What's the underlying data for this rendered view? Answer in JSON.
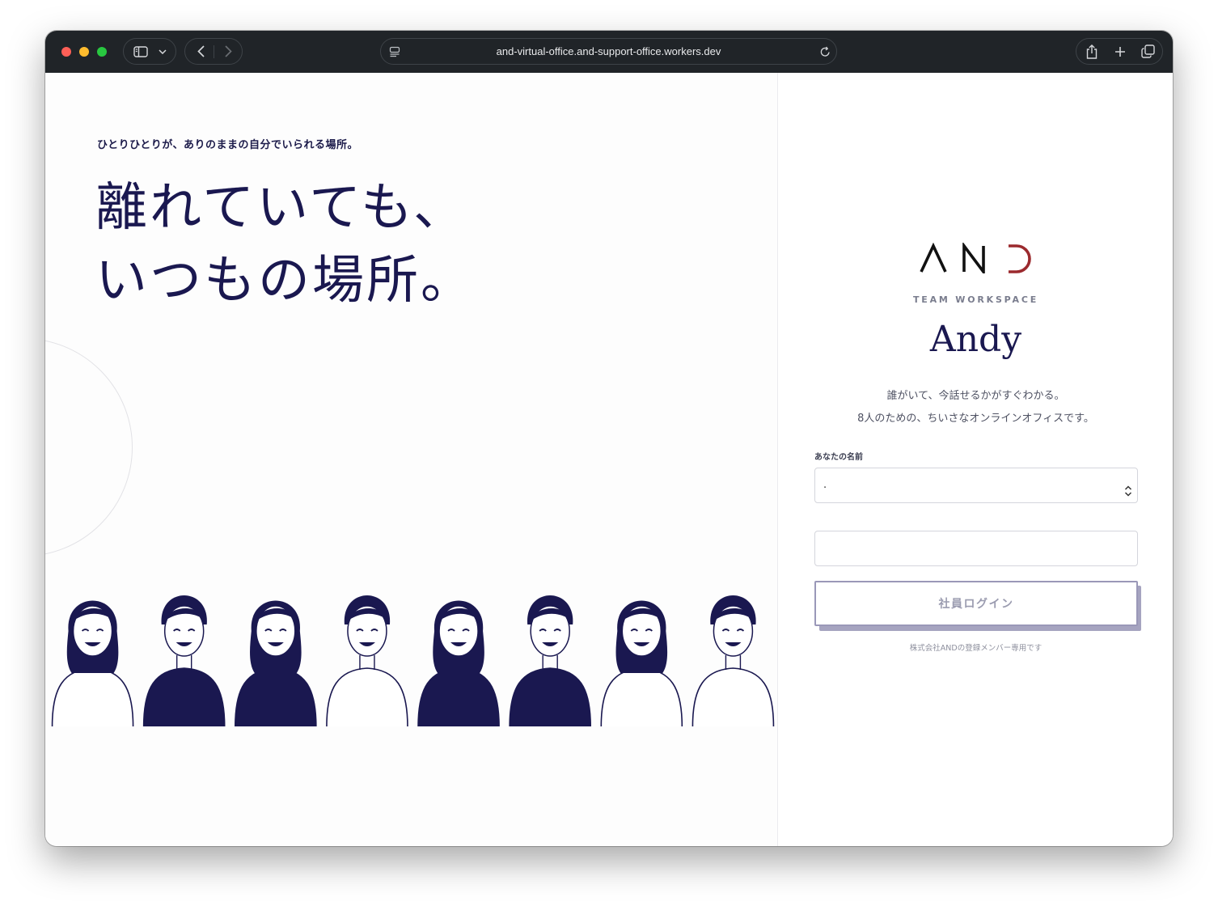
{
  "browser": {
    "url": "and-virtual-office.and-support-office.workers.dev"
  },
  "hero": {
    "tagline": "ひとりひとりが、ありのままの自分でいられる場所。",
    "headline_line1": "離れていても、",
    "headline_line2": "いつもの場所。",
    "illustration": "team-members-illustration",
    "member_count": 8
  },
  "login": {
    "logo_text": "AND",
    "workspace_label": "TEAM WORKSPACE",
    "app_name": "Andy",
    "description_line1": "誰がいて、今話せるかがすぐわかる。",
    "description_line2": "8人のための、ちいさなオンラインオフィスです。",
    "name_label": "あなたの名前",
    "name_select_value": ".",
    "login_button": "社員ログイン",
    "note": "株式会社ANDの登録メンバー専用です"
  },
  "colors": {
    "navy": "#1a1850",
    "logo_accent": "#9b2a2e",
    "button_border": "#9a98b8",
    "toolbar": "#202428"
  }
}
